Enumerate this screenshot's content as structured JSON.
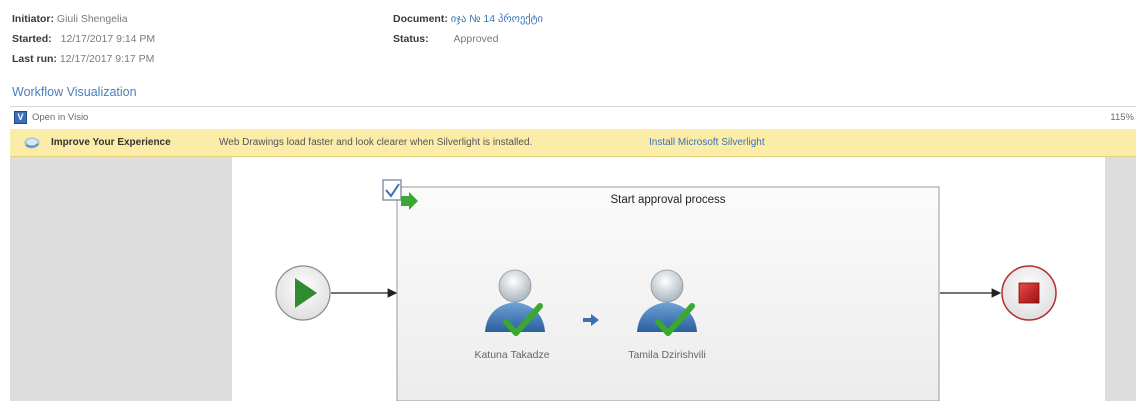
{
  "meta": {
    "initiator_label": "Initiator:",
    "initiator_value": "Giuli Shengelia",
    "started_label": "Started:",
    "started_value": "12/17/2017 9:14 PM",
    "lastrun_label": "Last run:",
    "lastrun_value": "12/17/2017 9:17 PM",
    "document_label": "Document:",
    "document_value": "იჯა № 14 პროექტი",
    "status_label": "Status:",
    "status_value": "Approved"
  },
  "workflow": {
    "title": "Workflow Visualization",
    "open_in_visio": "Open in Visio",
    "zoom": "115%",
    "banner": {
      "bold": "Improve Your Experience",
      "text": "Web Drawings load faster and look clearer when Silverlight is installed.",
      "link": "Install Microsoft Silverlight"
    }
  },
  "diagram": {
    "stage_title": "Start approval process",
    "approvers": [
      {
        "name": "Katuna Takadze"
      },
      {
        "name": "Tamila Dzirishvili"
      }
    ]
  },
  "colors": {
    "link": "#3b73b9",
    "banner": "#fbeca8",
    "start": "#2e8b2e",
    "end": "#cc2020",
    "check": "#3aa832"
  }
}
